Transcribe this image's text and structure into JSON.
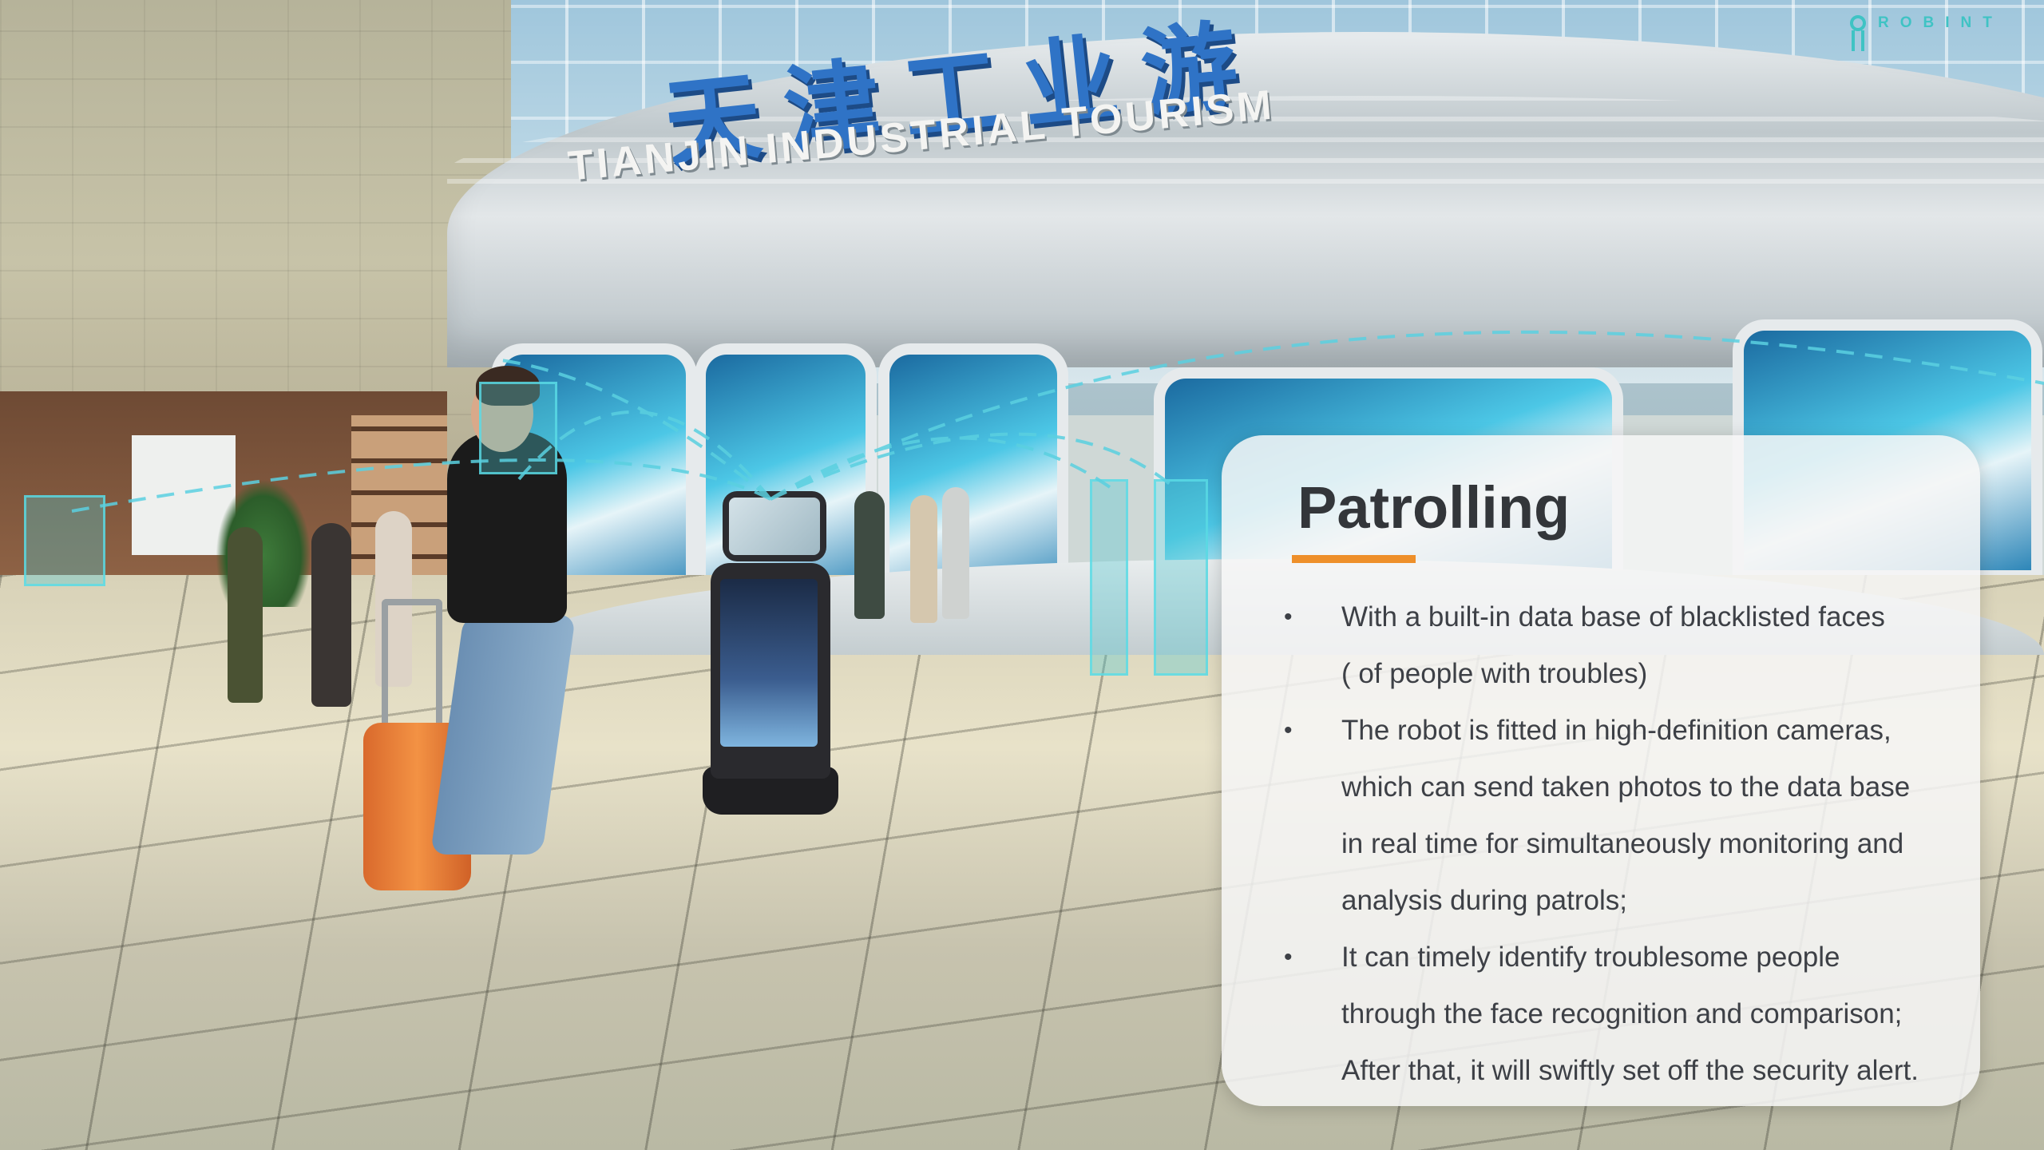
{
  "scene": {
    "sign_chinese": "天津工业游",
    "sign_english": "TIANJIN INDUSTRIAL TOURISM"
  },
  "logo": {
    "name": "ROBINT",
    "subtitle": "",
    "icon": "robint-logo-icon",
    "color": "#3fc3c4"
  },
  "card": {
    "title": "Patrolling",
    "accent_color": "#ee8f2a",
    "bullets": [
      {
        "lines": [
          "With a  built-in data base of blacklisted faces",
          "( of people with troubles)"
        ]
      },
      {
        "lines": [
          "The robot is fitted in high-definition cameras,",
          "which can send taken photos to the data base",
          "in real time for simultaneously monitoring and",
          "analysis during patrols;"
        ]
      },
      {
        "lines": [
          "It can timely identify troublesome people",
          "through the face recognition and comparison;",
          "After that, it will swiftly set off the security alert."
        ]
      }
    ]
  },
  "colors": {
    "face_box": "#5adce6",
    "sign_blue": "#2f73c6"
  }
}
